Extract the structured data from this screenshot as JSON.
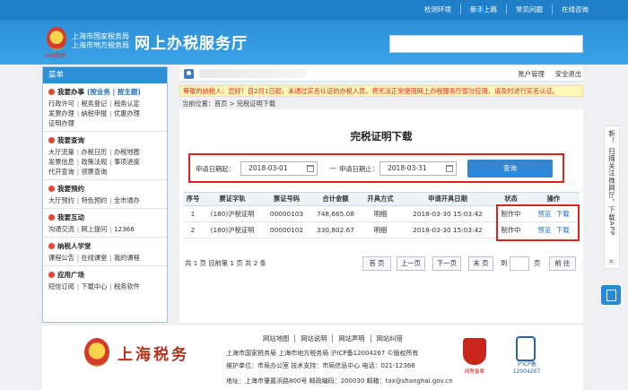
{
  "top_links": [
    "检测环境",
    "新手上路",
    "常见问题",
    "在线咨询"
  ],
  "header": {
    "bureau_line1": "上海市国家税务局",
    "bureau_line2": "上海市地方税务局",
    "site_title": "网上办税服务厅",
    "emblem_text": "中国税务",
    "search_placeholder": ""
  },
  "menu": {
    "head": "菜单",
    "sections": [
      {
        "title": "我要办事",
        "extra": "(按业务 | 按主题)",
        "rows": [
          [
            "行政许可",
            "税务登记",
            "税务认定"
          ],
          [
            "发票办理",
            "纳税申报",
            "优惠办理"
          ],
          [
            "证明办理"
          ]
        ]
      },
      {
        "title": "我要查询",
        "extra": "",
        "rows": [
          [
            "大厅流量",
            "办税日历",
            "办税地图"
          ],
          [
            "发票信息",
            "政策法规",
            "事项进度"
          ],
          [
            "代开查询",
            "领票查询"
          ]
        ]
      },
      {
        "title": "我要预约",
        "extra": "",
        "rows": [
          [
            "大厅预约",
            "特色预约",
            "全市通办"
          ]
        ]
      },
      {
        "title": "我要互动",
        "extra": "",
        "rows": [
          [
            "沟通交流",
            "网上提问",
            "12366"
          ]
        ]
      },
      {
        "title": "纳税人学堂",
        "extra": "",
        "rows": [
          [
            "课程公告",
            "在线课堂",
            "我的课程"
          ]
        ]
      },
      {
        "title": "应用广场",
        "extra": "",
        "rows": [
          [
            "短信订阅",
            "下载中心",
            "税务软件"
          ]
        ]
      }
    ]
  },
  "user": {
    "account_manage": "账户管理",
    "logout": "安全退出"
  },
  "notice": "尊敬的纳税人：您好！自2月1日起，未通过实名认证的办税人员，将无法正常使用网上办税服务厅部分应用，请及时进行实名认证。",
  "breadcrumb": "当前位置：首页 > 完税证明下载",
  "page_title": "完税证明下载",
  "query": {
    "start_label": "申请日期起：",
    "start_value": "2018-03-01",
    "dash": "—",
    "end_label": "申请日期止：",
    "end_value": "2018-03-31",
    "button": "查询"
  },
  "table": {
    "headers": [
      "序号",
      "票证字轨",
      "票证号码",
      "合计金额",
      "开具方式",
      "申请开具日期",
      "状态",
      "操作"
    ],
    "rows": [
      {
        "no": "1",
        "ticket_type": "(180)沪税证明",
        "ticket_no": "00000103",
        "amount": "748,665.08",
        "method": "明细",
        "date": "2018-03-30 15:03:42",
        "status": "制作中",
        "preview": "预览",
        "download": "下载"
      },
      {
        "no": "2",
        "ticket_type": "(180)沪税证明",
        "ticket_no": "00000102",
        "amount": "330,802.67",
        "method": "明细",
        "date": "2018-03-30 15:03:42",
        "status": "制作中",
        "preview": "预览",
        "download": "下载"
      }
    ]
  },
  "pager": {
    "info": "共 1 页  目前第 1 页  共 2 条",
    "first": "首 页",
    "prev": "上一页",
    "next": "下一页",
    "last": "末 页",
    "goto_prefix": "到",
    "goto_suffix": "页",
    "go": "前 往"
  },
  "side": {
    "text": "新！ 扫描关注微网厅，下载APP",
    "close": "×"
  },
  "footer": {
    "links": [
      "网站地图",
      "网站说明",
      "网站声明",
      "网站纠错"
    ],
    "line1": "上海市国家税务局 上海市地方税务局 沪ICP备12004267 ©版权所有",
    "line2": "维护单位：市局办公室  技术支持：市局信息中心 电话：021-12366",
    "line3": "地址：上海市肇嘉浜路800号   邮政编码：200030   邮箱：tax@shanghai.gov.cn",
    "logo_text": "上海税务",
    "police_label": "网警备案",
    "icp_label_1": "沪ICP备",
    "icp_label_2": "12004267"
  },
  "colors": {
    "brand_blue": "#2b8fd8",
    "alert_red": "#d9261c",
    "link_blue": "#1a6fc8"
  }
}
